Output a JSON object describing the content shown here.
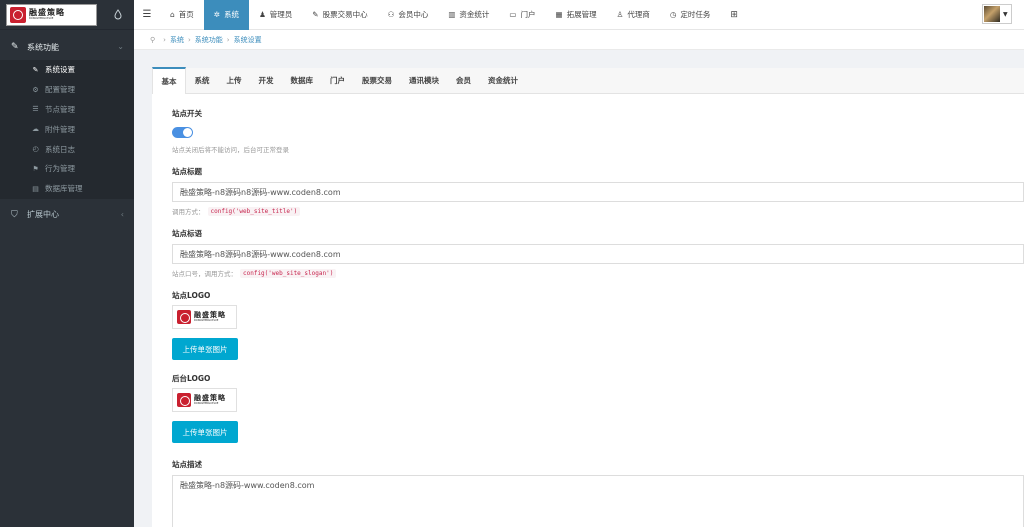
{
  "logo": {
    "cn": "融盛策略",
    "en": "RONGSHENGCELUE"
  },
  "sidebar": {
    "group1": "系统功能",
    "items": [
      {
        "label": "系统设置",
        "icon": "wrench-icon",
        "glyph": "✎"
      },
      {
        "label": "配置管理",
        "icon": "cogs-icon",
        "glyph": "⚙"
      },
      {
        "label": "节点管理",
        "icon": "list-icon",
        "glyph": "☰"
      },
      {
        "label": "附件管理",
        "icon": "cloud-icon",
        "glyph": "☁"
      },
      {
        "label": "系统日志",
        "icon": "history-icon",
        "glyph": "◴"
      },
      {
        "label": "行为管理",
        "icon": "flag-icon",
        "glyph": "⚑"
      },
      {
        "label": "数据库管理",
        "icon": "database-icon",
        "glyph": "▤"
      }
    ],
    "group2": "扩展中心"
  },
  "topnav": {
    "items": [
      {
        "label": "首页",
        "glyph": "⌂"
      },
      {
        "label": "系统",
        "glyph": "✲"
      },
      {
        "label": "管理员",
        "glyph": "♟"
      },
      {
        "label": "股票交易中心",
        "glyph": "✎"
      },
      {
        "label": "会员中心",
        "glyph": "⚇"
      },
      {
        "label": "资金统计",
        "glyph": "▥"
      },
      {
        "label": "门户",
        "glyph": "▭"
      },
      {
        "label": "拓展管理",
        "glyph": "▦"
      },
      {
        "label": "代理商",
        "glyph": "♙"
      },
      {
        "label": "定时任务",
        "glyph": "◷"
      }
    ]
  },
  "breadcrumb": [
    "系统",
    "系统功能",
    "系统设置"
  ],
  "tabs": [
    "基本",
    "系统",
    "上传",
    "开发",
    "数据库",
    "门户",
    "股票交易",
    "通讯模块",
    "会员",
    "资金统计"
  ],
  "form": {
    "switch_label": "站点开关",
    "switch_help": "站点关闭后将不能访问，后台可正常登录",
    "switch_on": true,
    "title_label": "站点标题",
    "title_value": "融盛策略-n8源码n8源码-www.coden8.com",
    "title_help": "调用方式：",
    "title_code": "config('web_site_title')",
    "slogan_label": "站点标语",
    "slogan_value": "融盛策略-n8源码n8源码-www.coden8.com",
    "slogan_help": "站点口号，调用方式：",
    "slogan_code": "config('web_site_slogan')",
    "logo_label": "站点LOGO",
    "upload_btn": "上传单张图片",
    "admin_logo_label": "后台LOGO",
    "upload_btn2": "上传单张图片",
    "desc_label": "站点描述",
    "desc_value": "融盛策略-n8源码-www.coden8.com"
  }
}
